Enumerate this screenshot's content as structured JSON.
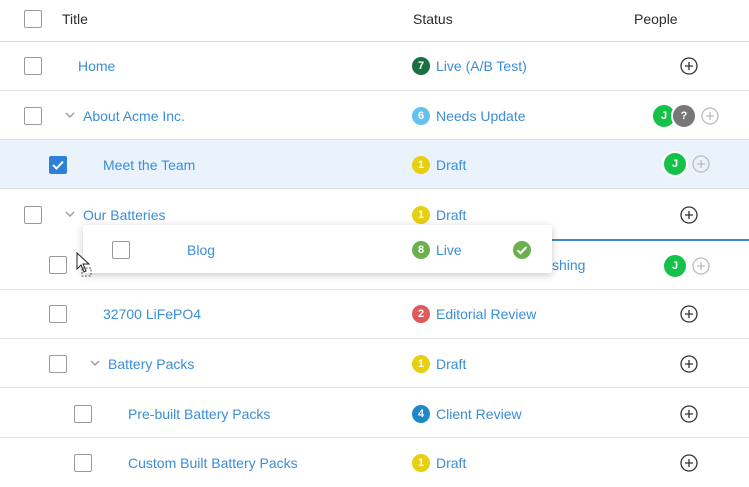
{
  "header": {
    "title": "Title",
    "status": "Status",
    "people": "People"
  },
  "rows": [
    {
      "title": "Home",
      "status_num": "7",
      "status_color": "#1a6f41",
      "status": "Live (A/B Test)"
    },
    {
      "title": "About Acme Inc.",
      "status_num": "6",
      "status_color": "#64c1ed",
      "status": "Needs Update",
      "avatars": [
        "J",
        "?"
      ]
    },
    {
      "title": "Meet the Team",
      "status_num": "1",
      "status_color": "#e7cf12",
      "status": "Draft",
      "avatars": [
        "J"
      ]
    },
    {
      "title": "Our Batteries",
      "status_num": "1",
      "status_color": "#e7cf12",
      "status": "Draft"
    },
    {
      "hidden_status_text": "shing",
      "avatars": [
        "J"
      ]
    },
    {
      "title": "32700 LiFePO4",
      "status_num": "2",
      "status_color": "#e05a5a",
      "status": "Editorial Review"
    },
    {
      "title": "Battery Packs",
      "status_num": "1",
      "status_color": "#e7cf12",
      "status": "Draft"
    },
    {
      "title": "Pre-built Battery Packs",
      "status_num": "4",
      "status_color": "#1f88c9",
      "status": "Client Review"
    },
    {
      "title": "Custom Built Battery Packs",
      "status_num": "1",
      "status_color": "#e7cf12",
      "status": "Draft"
    }
  ],
  "drag_card": {
    "title": "Blog",
    "status_num": "8",
    "status_color": "#6ab04c",
    "status": "Live"
  },
  "colors": {
    "accent": "#3a8dd8",
    "checked": "#2d7fd7",
    "avatar_green": "#14c24a",
    "avatar_gray": "#777777"
  }
}
